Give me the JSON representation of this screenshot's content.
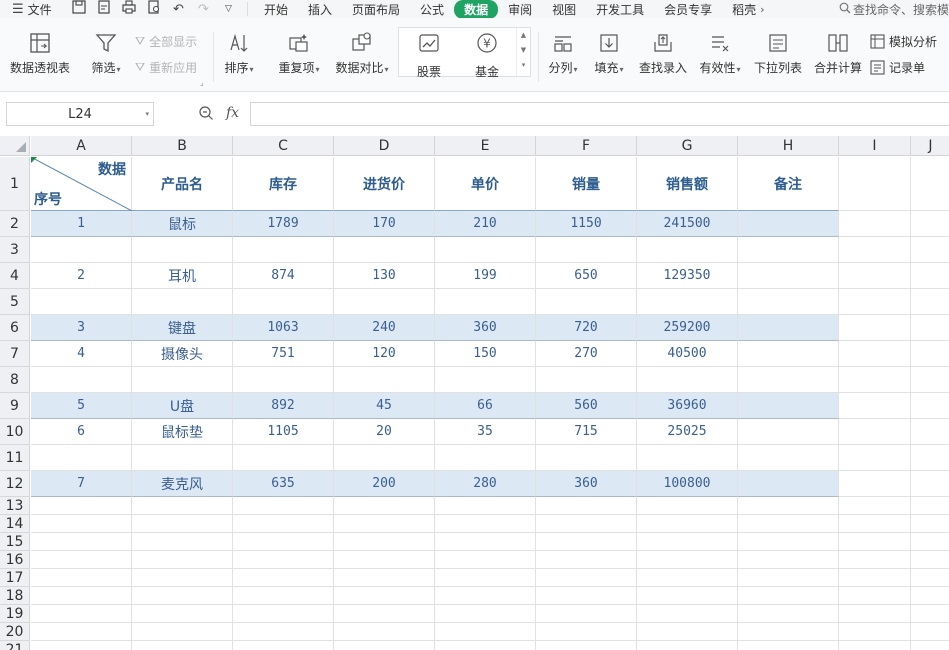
{
  "menu": {
    "file_label": "文件",
    "tabs": [
      "开始",
      "插入",
      "页面布局",
      "公式",
      "数据",
      "审阅",
      "视图",
      "开发工具",
      "会员专享",
      "稻壳"
    ],
    "active_tab": "数据",
    "search_label": "查找命令、搜索模"
  },
  "ribbon": {
    "pivot_label": "数据透视表",
    "filter_label": "筛选",
    "show_all_label": "全部显示",
    "reapply_label": "重新应用",
    "sort_label": "排序",
    "duplicate_label": "重复项",
    "compare_label": "数据对比",
    "stock_label": "股票",
    "fund_label": "基金",
    "split_label": "分列",
    "fill_label": "填充",
    "lookup_label": "查找录入",
    "validity_label": "有效性",
    "dropdown_label": "下拉列表",
    "consolidate_label": "合并计算",
    "whatif_label": "模拟分析",
    "record_label": "记录单"
  },
  "formula_bar": {
    "name_box": "L24",
    "formula": ""
  },
  "sheet": {
    "columns": [
      "A",
      "B",
      "C",
      "D",
      "E",
      "F",
      "G",
      "H",
      "I",
      "J"
    ],
    "row_numbers": [
      "1",
      "2",
      "3",
      "4",
      "5",
      "6",
      "7",
      "8",
      "9",
      "10",
      "11",
      "12",
      "13",
      "14",
      "15",
      "16",
      "17",
      "18",
      "19",
      "20",
      "21"
    ],
    "diag_header": {
      "top_right": "数据",
      "bottom_left": "序号"
    },
    "headers": [
      "产品名",
      "库存",
      "进货价",
      "单价",
      "销量",
      "销售额",
      "备注"
    ],
    "rows": [
      {
        "row": "2",
        "no": "1",
        "name": "鼠标",
        "stock": "1789",
        "cost": "170",
        "price": "210",
        "sales": "1150",
        "revenue": "241500",
        "note": ""
      },
      {
        "row": "4",
        "no": "2",
        "name": "耳机",
        "stock": "874",
        "cost": "130",
        "price": "199",
        "sales": "650",
        "revenue": "129350",
        "note": ""
      },
      {
        "row": "6",
        "no": "3",
        "name": "键盘",
        "stock": "1063",
        "cost": "240",
        "price": "360",
        "sales": "720",
        "revenue": "259200",
        "note": ""
      },
      {
        "row": "7",
        "no": "4",
        "name": "摄像头",
        "stock": "751",
        "cost": "120",
        "price": "150",
        "sales": "270",
        "revenue": "40500",
        "note": ""
      },
      {
        "row": "9",
        "no": "5",
        "name": "U盘",
        "stock": "892",
        "cost": "45",
        "price": "66",
        "sales": "560",
        "revenue": "36960",
        "note": ""
      },
      {
        "row": "10",
        "no": "6",
        "name": "鼠标垫",
        "stock": "1105",
        "cost": "20",
        "price": "35",
        "sales": "715",
        "revenue": "25025",
        "note": ""
      },
      {
        "row": "12",
        "no": "7",
        "name": "麦克风",
        "stock": "635",
        "cost": "200",
        "price": "280",
        "sales": "360",
        "revenue": "100800",
        "note": ""
      }
    ]
  }
}
